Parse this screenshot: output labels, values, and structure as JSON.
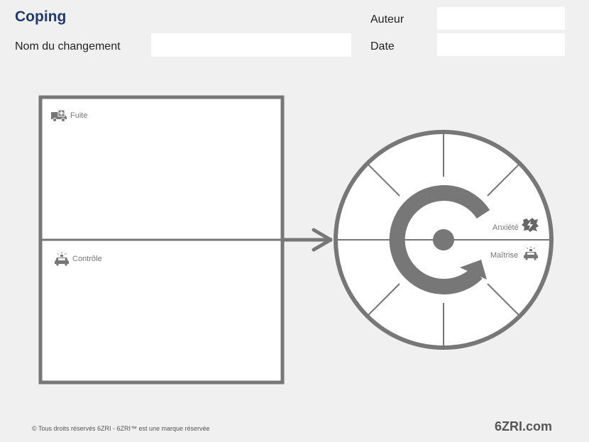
{
  "header": {
    "title": "Coping",
    "change_name_label": "Nom du changement",
    "change_name_value": "",
    "author_label": "Auteur",
    "author_value": "",
    "date_label": "Date",
    "date_value": ""
  },
  "quadrant": {
    "top_label": "Fuite",
    "top_icon": "ambulance-icon",
    "bottom_label": "Contrôle",
    "bottom_icon": "police-car-icon"
  },
  "wheel": {
    "upper_label": "Anxiété",
    "upper_icon": "lightning-stress-icon",
    "lower_label": "Maîtrise",
    "lower_icon": "police-car-icon"
  },
  "footer": {
    "copyright": "© Tous droits réservés 6ZRI - 6ZRI™ est une marque réservée",
    "brand": "6ZRI.com"
  },
  "colors": {
    "title": "#1f3a6d",
    "frame": "#777777",
    "background": "#f0f0f0"
  }
}
